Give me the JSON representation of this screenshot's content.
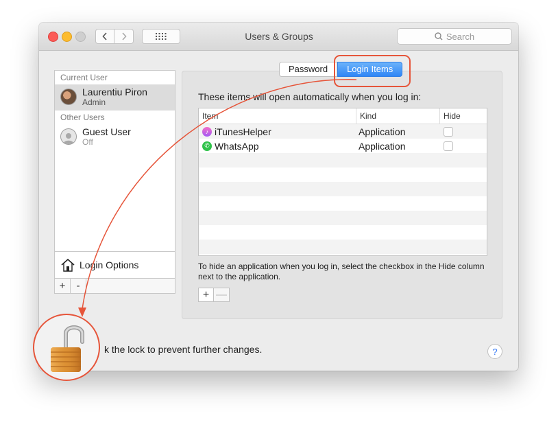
{
  "window": {
    "title": "Users & Groups"
  },
  "search": {
    "placeholder": "Search"
  },
  "sidebar": {
    "current_user_heading": "Current User",
    "current_user": {
      "name": "Laurentiu Piron",
      "role": "Admin"
    },
    "other_users_heading": "Other Users",
    "other_users": [
      {
        "name": "Guest User",
        "status": "Off"
      }
    ],
    "login_options_label": "Login Options",
    "add_label": "+",
    "remove_label": "-"
  },
  "tabs": [
    {
      "label": "Password",
      "active": false
    },
    {
      "label": "Login Items",
      "active": true
    }
  ],
  "login_items": {
    "intro": "These items will open automatically when you log in:",
    "columns": {
      "item": "Item",
      "kind": "Kind",
      "hide": "Hide"
    },
    "rows": [
      {
        "item": "iTunesHelper",
        "kind": "Application",
        "hide": false,
        "icon": "itunes-icon"
      },
      {
        "item": "WhatsApp",
        "kind": "Application",
        "hide": false,
        "icon": "whatsapp-icon"
      }
    ],
    "hint": "To hide an application when you log in, select the checkbox in the Hide column next to the application.",
    "add_label": "+",
    "remove_label": "—"
  },
  "footer": {
    "lock_text": "k the lock to prevent further changes.",
    "help_label": "?"
  },
  "colors": {
    "annotation": "#e6553a",
    "accent": "#2f86f6"
  }
}
